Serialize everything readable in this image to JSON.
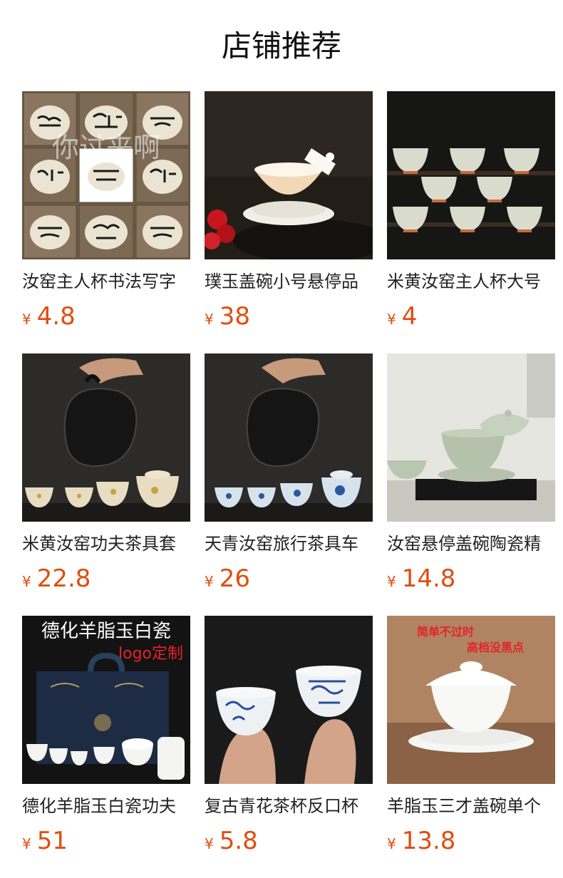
{
  "header": {
    "title": "店铺推荐"
  },
  "products": [
    {
      "name": "汝窑主人杯书法写字",
      "price_symbol": "¥",
      "price": "4.8",
      "overlay": "你过来啊"
    },
    {
      "name": "璞玉盖碗小号悬停品",
      "price_symbol": "¥",
      "price": "38"
    },
    {
      "name": "米黄汝窑主人杯大号",
      "price_symbol": "¥",
      "price": "4"
    },
    {
      "name": "米黄汝窑功夫茶具套",
      "price_symbol": "¥",
      "price": "22.8"
    },
    {
      "name": "天青汝窑旅行茶具车",
      "price_symbol": "¥",
      "price": "26"
    },
    {
      "name": "汝窑悬停盖碗陶瓷精",
      "price_symbol": "¥",
      "price": "14.8"
    },
    {
      "name": "德化羊脂玉白瓷功夫",
      "price_symbol": "¥",
      "price": "51",
      "overlay_title": "德化羊脂玉白瓷",
      "overlay_logo": "logo定制"
    },
    {
      "name": "复古青花茶杯反口杯",
      "price_symbol": "¥",
      "price": "5.8"
    },
    {
      "name": "羊脂玉三才盖碗单个",
      "price_symbol": "¥",
      "price": "13.8",
      "overlay_line1": "简单不过时",
      "overlay_line2": "高档没黑点"
    }
  ]
}
